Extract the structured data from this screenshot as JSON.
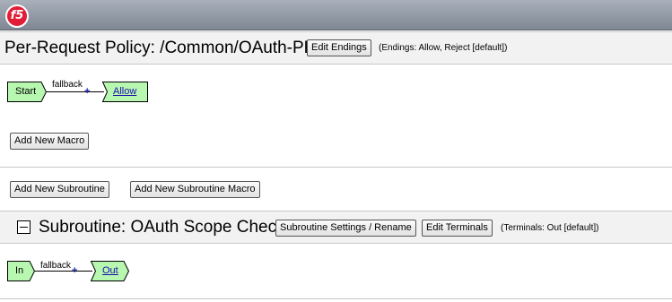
{
  "header": {
    "logo_text": "f5"
  },
  "policy": {
    "title": "Per-Request Policy: /Common/OAuth-PRP",
    "edit_endings_label": "Edit Endings",
    "endings_note": "(Endings: Allow, Reject [default])",
    "flow": {
      "start_label": "Start",
      "edge_label": "fallback",
      "plus": "+",
      "end_label": "Allow"
    },
    "add_macro_label": "Add New Macro",
    "add_subroutine_label": "Add New Subroutine",
    "add_subroutine_macro_label": "Add New Subroutine Macro"
  },
  "subroutine": {
    "title": "Subroutine: OAuth Scope Check",
    "settings_label": "Subroutine Settings / Rename",
    "edit_terminals_label": "Edit Terminals",
    "terminals_note": "(Terminals: Out [default])",
    "flow": {
      "start_label": "In",
      "edge_label": "fallback",
      "plus": "+",
      "end_label": "Out"
    }
  },
  "colors": {
    "node_fill": "#b7f7b0",
    "link": "#1a0dab",
    "logo": "#e21d38"
  }
}
